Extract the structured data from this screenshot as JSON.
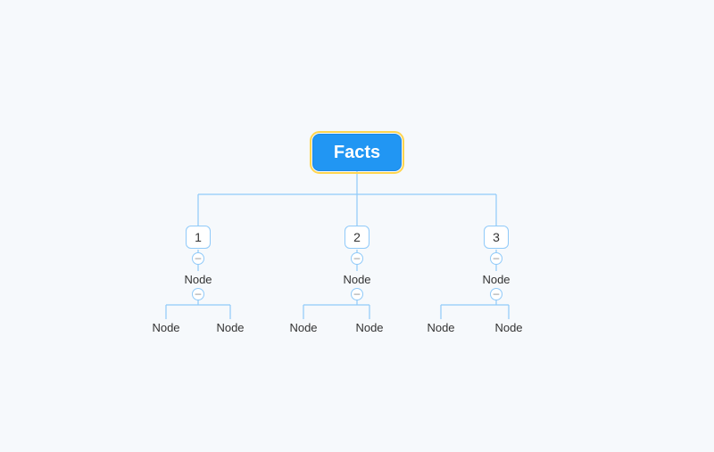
{
  "root": {
    "label": "Facts"
  },
  "branches": [
    {
      "num": "1",
      "mid": "Node",
      "leafL": "Node",
      "leafR": "Node"
    },
    {
      "num": "2",
      "mid": "Node",
      "leafL": "Node",
      "leafR": "Node"
    },
    {
      "num": "3",
      "mid": "Node",
      "leafL": "Node",
      "leafR": "Node"
    }
  ],
  "toggle_glyph": "–",
  "colors": {
    "accent": "#2196f3",
    "line": "#90caf9",
    "highlight": "#ffd54f"
  }
}
